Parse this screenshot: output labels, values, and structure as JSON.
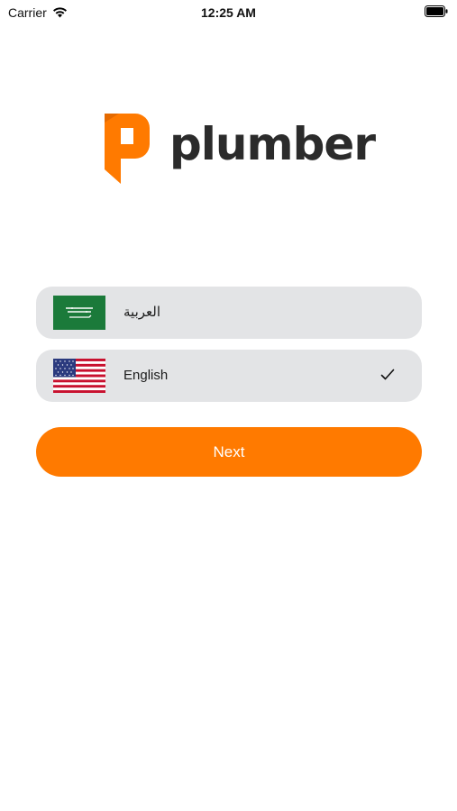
{
  "status_bar": {
    "carrier": "Carrier",
    "time": "12:25 AM"
  },
  "logo": {
    "text": "plumber",
    "brand_color": "#ff7a00",
    "text_color": "#2b2b2b"
  },
  "languages": [
    {
      "label": "العربية",
      "flag": "saudi-arabia-flag",
      "selected": false
    },
    {
      "label": "English",
      "flag": "united-states-flag",
      "selected": true
    }
  ],
  "next_button": {
    "label": "Next",
    "color": "#ff7a00"
  }
}
